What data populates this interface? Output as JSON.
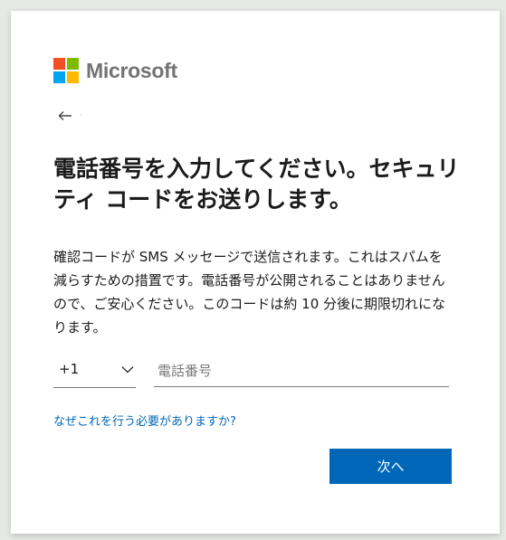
{
  "brand": {
    "name": "Microsoft",
    "logo_colors": [
      "#f25022",
      "#7fba00",
      "#00a4ef",
      "#ffb900"
    ]
  },
  "back_icon": "arrow-left-icon",
  "heading": "電話番号を入力してください。セキュリティ コードをお送りします。",
  "description": "確認コードが SMS メッセージで送信されます。これはスパムを減らすための措置です。電話番号が公開されることはありませんので、ご安心ください。このコードは約 10 分後に期限切れになります。",
  "form": {
    "country_code": "+1",
    "country_chevron_icon": "chevron-down-icon",
    "phone_placeholder": "電話番号",
    "phone_value": ""
  },
  "why_link": "なぜこれを行う必要がありますか?",
  "next_button": "次へ",
  "colors": {
    "accent": "#0067b8",
    "heading_text": "#1b1b1b",
    "logo_text": "#737373"
  }
}
